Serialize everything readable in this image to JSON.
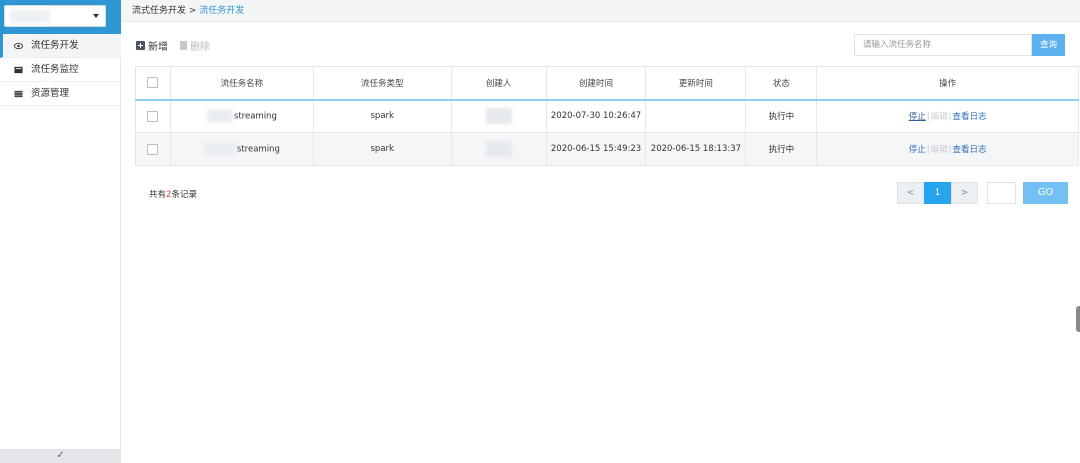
{
  "sidebar": {
    "items": [
      {
        "label": "流任务开发",
        "icon": "eye-icon",
        "active": true
      },
      {
        "label": "流任务监控",
        "icon": "monitor-icon",
        "active": false
      },
      {
        "label": "资源管理",
        "icon": "storage-icon",
        "active": false
      }
    ],
    "collapse_glyph": "✓"
  },
  "breadcrumb": {
    "parent": "流式任务开发",
    "separator": " > ",
    "current": "流任务开发"
  },
  "toolbar": {
    "add_label": "新增",
    "delete_label": "删除"
  },
  "search": {
    "placeholder": "请输入流任务名称",
    "button_label": "查询"
  },
  "table": {
    "headers": [
      "流任务名称",
      "流任务类型",
      "创建人",
      "创建时间",
      "更新时间",
      "状态",
      "操作"
    ],
    "rows": [
      {
        "name": "streaming",
        "type": "spark",
        "create_time": "2020-07-30 10:26:47",
        "update_time": "",
        "status": "执行中",
        "ops": {
          "stop": "停止",
          "edit": "编辑",
          "log": "查看日志"
        }
      },
      {
        "name": "streaming",
        "type": "spark",
        "create_time": "2020-06-15 15:49:23",
        "update_time": "2020-06-15 18:13:37",
        "status": "执行中",
        "ops": {
          "stop": "停止",
          "edit": "编辑",
          "log": "查看日志"
        }
      }
    ]
  },
  "footer": {
    "total_prefix": "共有",
    "total_count": "2",
    "total_suffix": "条记录"
  },
  "pagination": {
    "prev": "<",
    "current_page": "1",
    "next": ">",
    "go_label": "GO"
  }
}
